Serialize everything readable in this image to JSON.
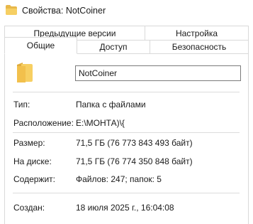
{
  "window": {
    "title": "Свойства: NotCoiner",
    "folder_icon": "folder-icon"
  },
  "tabs": {
    "row1": [
      {
        "label": "Предыдущие версии"
      },
      {
        "label": "Настройка"
      }
    ],
    "row2": [
      {
        "label": "Общие",
        "selected": true
      },
      {
        "label": "Доступ"
      },
      {
        "label": "Безопасность"
      }
    ]
  },
  "general": {
    "name_value": "NotCoiner",
    "type_label": "Тип:",
    "type_value": "Папка с файлами",
    "location_label": "Расположение:",
    "location_value": "E:\\МОНТА)\\{",
    "size_label": "Размер:",
    "size_value": "71,5 ГБ (76 773 843 493 байт)",
    "disk_label": "На диске:",
    "disk_value": "71,5 ГБ (76 774 350 848 байт)",
    "contains_label": "Содержит:",
    "contains_value": "Файлов: 247; папок: 5",
    "created_label": "Создан:",
    "created_value": "18 июля 2025 г., 16:04:08"
  },
  "colors": {
    "folder": "#f4c95d",
    "folder_dark": "#d9a93a",
    "border": "#d9d9d9"
  }
}
